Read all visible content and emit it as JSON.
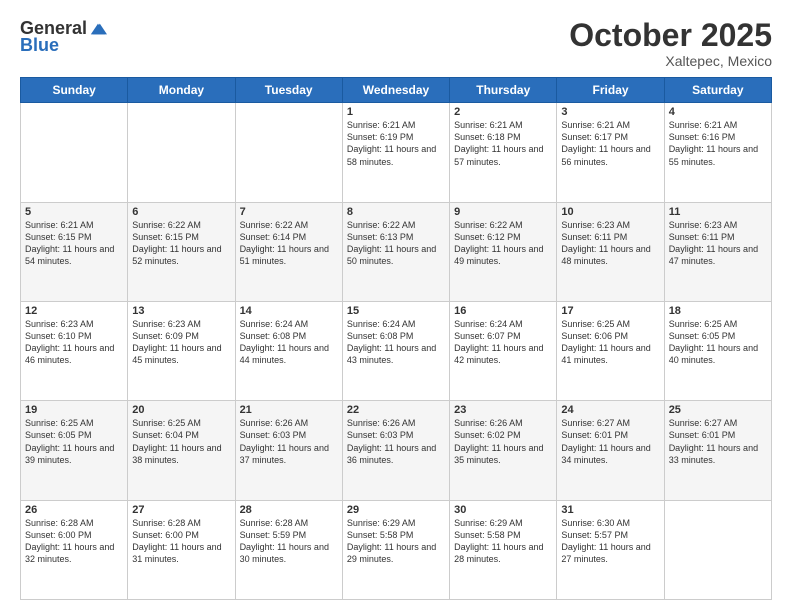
{
  "logo": {
    "general": "General",
    "blue": "Blue"
  },
  "title": "October 2025",
  "subtitle": "Xaltepec, Mexico",
  "days_header": [
    "Sunday",
    "Monday",
    "Tuesday",
    "Wednesday",
    "Thursday",
    "Friday",
    "Saturday"
  ],
  "weeks": [
    [
      {
        "day": "",
        "sunrise": "",
        "sunset": "",
        "daylight": ""
      },
      {
        "day": "",
        "sunrise": "",
        "sunset": "",
        "daylight": ""
      },
      {
        "day": "",
        "sunrise": "",
        "sunset": "",
        "daylight": ""
      },
      {
        "day": "1",
        "sunrise": "Sunrise: 6:21 AM",
        "sunset": "Sunset: 6:19 PM",
        "daylight": "Daylight: 11 hours and 58 minutes."
      },
      {
        "day": "2",
        "sunrise": "Sunrise: 6:21 AM",
        "sunset": "Sunset: 6:18 PM",
        "daylight": "Daylight: 11 hours and 57 minutes."
      },
      {
        "day": "3",
        "sunrise": "Sunrise: 6:21 AM",
        "sunset": "Sunset: 6:17 PM",
        "daylight": "Daylight: 11 hours and 56 minutes."
      },
      {
        "day": "4",
        "sunrise": "Sunrise: 6:21 AM",
        "sunset": "Sunset: 6:16 PM",
        "daylight": "Daylight: 11 hours and 55 minutes."
      }
    ],
    [
      {
        "day": "5",
        "sunrise": "Sunrise: 6:21 AM",
        "sunset": "Sunset: 6:15 PM",
        "daylight": "Daylight: 11 hours and 54 minutes."
      },
      {
        "day": "6",
        "sunrise": "Sunrise: 6:22 AM",
        "sunset": "Sunset: 6:15 PM",
        "daylight": "Daylight: 11 hours and 52 minutes."
      },
      {
        "day": "7",
        "sunrise": "Sunrise: 6:22 AM",
        "sunset": "Sunset: 6:14 PM",
        "daylight": "Daylight: 11 hours and 51 minutes."
      },
      {
        "day": "8",
        "sunrise": "Sunrise: 6:22 AM",
        "sunset": "Sunset: 6:13 PM",
        "daylight": "Daylight: 11 hours and 50 minutes."
      },
      {
        "day": "9",
        "sunrise": "Sunrise: 6:22 AM",
        "sunset": "Sunset: 6:12 PM",
        "daylight": "Daylight: 11 hours and 49 minutes."
      },
      {
        "day": "10",
        "sunrise": "Sunrise: 6:23 AM",
        "sunset": "Sunset: 6:11 PM",
        "daylight": "Daylight: 11 hours and 48 minutes."
      },
      {
        "day": "11",
        "sunrise": "Sunrise: 6:23 AM",
        "sunset": "Sunset: 6:11 PM",
        "daylight": "Daylight: 11 hours and 47 minutes."
      }
    ],
    [
      {
        "day": "12",
        "sunrise": "Sunrise: 6:23 AM",
        "sunset": "Sunset: 6:10 PM",
        "daylight": "Daylight: 11 hours and 46 minutes."
      },
      {
        "day": "13",
        "sunrise": "Sunrise: 6:23 AM",
        "sunset": "Sunset: 6:09 PM",
        "daylight": "Daylight: 11 hours and 45 minutes."
      },
      {
        "day": "14",
        "sunrise": "Sunrise: 6:24 AM",
        "sunset": "Sunset: 6:08 PM",
        "daylight": "Daylight: 11 hours and 44 minutes."
      },
      {
        "day": "15",
        "sunrise": "Sunrise: 6:24 AM",
        "sunset": "Sunset: 6:08 PM",
        "daylight": "Daylight: 11 hours and 43 minutes."
      },
      {
        "day": "16",
        "sunrise": "Sunrise: 6:24 AM",
        "sunset": "Sunset: 6:07 PM",
        "daylight": "Daylight: 11 hours and 42 minutes."
      },
      {
        "day": "17",
        "sunrise": "Sunrise: 6:25 AM",
        "sunset": "Sunset: 6:06 PM",
        "daylight": "Daylight: 11 hours and 41 minutes."
      },
      {
        "day": "18",
        "sunrise": "Sunrise: 6:25 AM",
        "sunset": "Sunset: 6:05 PM",
        "daylight": "Daylight: 11 hours and 40 minutes."
      }
    ],
    [
      {
        "day": "19",
        "sunrise": "Sunrise: 6:25 AM",
        "sunset": "Sunset: 6:05 PM",
        "daylight": "Daylight: 11 hours and 39 minutes."
      },
      {
        "day": "20",
        "sunrise": "Sunrise: 6:25 AM",
        "sunset": "Sunset: 6:04 PM",
        "daylight": "Daylight: 11 hours and 38 minutes."
      },
      {
        "day": "21",
        "sunrise": "Sunrise: 6:26 AM",
        "sunset": "Sunset: 6:03 PM",
        "daylight": "Daylight: 11 hours and 37 minutes."
      },
      {
        "day": "22",
        "sunrise": "Sunrise: 6:26 AM",
        "sunset": "Sunset: 6:03 PM",
        "daylight": "Daylight: 11 hours and 36 minutes."
      },
      {
        "day": "23",
        "sunrise": "Sunrise: 6:26 AM",
        "sunset": "Sunset: 6:02 PM",
        "daylight": "Daylight: 11 hours and 35 minutes."
      },
      {
        "day": "24",
        "sunrise": "Sunrise: 6:27 AM",
        "sunset": "Sunset: 6:01 PM",
        "daylight": "Daylight: 11 hours and 34 minutes."
      },
      {
        "day": "25",
        "sunrise": "Sunrise: 6:27 AM",
        "sunset": "Sunset: 6:01 PM",
        "daylight": "Daylight: 11 hours and 33 minutes."
      }
    ],
    [
      {
        "day": "26",
        "sunrise": "Sunrise: 6:28 AM",
        "sunset": "Sunset: 6:00 PM",
        "daylight": "Daylight: 11 hours and 32 minutes."
      },
      {
        "day": "27",
        "sunrise": "Sunrise: 6:28 AM",
        "sunset": "Sunset: 6:00 PM",
        "daylight": "Daylight: 11 hours and 31 minutes."
      },
      {
        "day": "28",
        "sunrise": "Sunrise: 6:28 AM",
        "sunset": "Sunset: 5:59 PM",
        "daylight": "Daylight: 11 hours and 30 minutes."
      },
      {
        "day": "29",
        "sunrise": "Sunrise: 6:29 AM",
        "sunset": "Sunset: 5:58 PM",
        "daylight": "Daylight: 11 hours and 29 minutes."
      },
      {
        "day": "30",
        "sunrise": "Sunrise: 6:29 AM",
        "sunset": "Sunset: 5:58 PM",
        "daylight": "Daylight: 11 hours and 28 minutes."
      },
      {
        "day": "31",
        "sunrise": "Sunrise: 6:30 AM",
        "sunset": "Sunset: 5:57 PM",
        "daylight": "Daylight: 11 hours and 27 minutes."
      },
      {
        "day": "",
        "sunrise": "",
        "sunset": "",
        "daylight": ""
      }
    ]
  ]
}
